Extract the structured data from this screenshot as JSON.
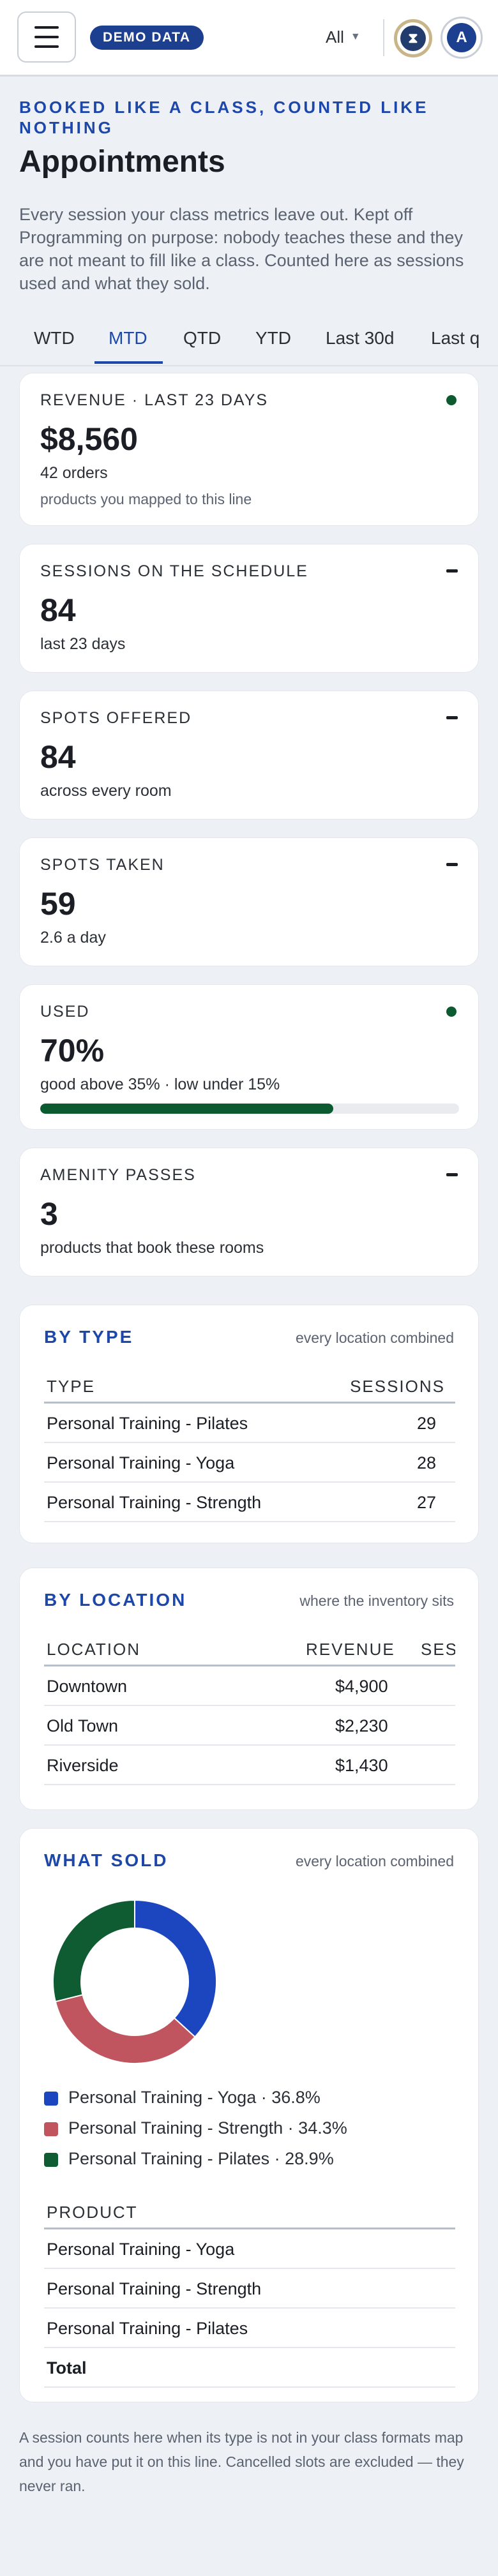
{
  "header": {
    "badge": "DEMO DATA",
    "filter_label": "All",
    "hourglass_glyph": "⧗",
    "avatar_initial": "A"
  },
  "page": {
    "eyebrow": "BOOKED LIKE A CLASS, COUNTED LIKE NOTHING",
    "title": "Appointments",
    "intro": "Every session your class metrics leave out. Kept off Programming on purpose: nobody teaches these and they are not meant to fill like a class. Counted here as sessions used and what they sold."
  },
  "tabs": [
    {
      "label": "WTD"
    },
    {
      "label": "MTD",
      "active": true
    },
    {
      "label": "QTD"
    },
    {
      "label": "YTD"
    },
    {
      "label": "Last 30d"
    },
    {
      "label": "Last q"
    }
  ],
  "kpis": {
    "revenue": {
      "label": "REVENUE · LAST 23 DAYS",
      "value": "$8,560",
      "sub": "42 orders",
      "sub2": "products you mapped to this line",
      "status": "dot"
    },
    "sessions": {
      "label": "SESSIONS ON THE SCHEDULE",
      "value": "84",
      "sub": "last 23 days",
      "status": "dash"
    },
    "spots_offered": {
      "label": "SPOTS OFFERED",
      "value": "84",
      "sub": "across every room",
      "status": "dash"
    },
    "spots_taken": {
      "label": "SPOTS TAKEN",
      "value": "59",
      "sub": "2.6 a day",
      "status": "dash"
    },
    "used": {
      "label": "USED",
      "value": "70%",
      "sub": "good above 35% · low under 15%",
      "progress": 0.7,
      "status": "dot"
    },
    "amenity": {
      "label": "AMENITY PASSES",
      "value": "3",
      "sub": "products that book these rooms",
      "status": "dash"
    }
  },
  "by_type": {
    "title": "BY TYPE",
    "note": "every location combined",
    "columns": [
      "TYPE",
      "SESSIONS"
    ],
    "rows": [
      {
        "name": "Personal Training - Pilates",
        "sessions": "29"
      },
      {
        "name": "Personal Training - Yoga",
        "sessions": "28"
      },
      {
        "name": "Personal Training - Strength",
        "sessions": "27"
      }
    ]
  },
  "by_location": {
    "title": "BY LOCATION",
    "note": "where the inventory sits",
    "columns": [
      "LOCATION",
      "REVENUE",
      "SES"
    ],
    "rows": [
      {
        "name": "Downtown",
        "revenue": "$4,900"
      },
      {
        "name": "Old Town",
        "revenue": "$2,230"
      },
      {
        "name": "Riverside",
        "revenue": "$1,430"
      }
    ]
  },
  "what_sold": {
    "title": "WHAT SOLD",
    "note": "every location combined",
    "legend": [
      {
        "label": "Personal Training - Yoga · 36.8%",
        "color": "#1c46c0"
      },
      {
        "label": "Personal Training - Strength · 34.3%",
        "color": "#c0555f"
      },
      {
        "label": "Personal Training - Pilates · 28.9%",
        "color": "#0f5c32"
      }
    ],
    "product_header": "PRODUCT",
    "products": [
      "Personal Training - Yoga",
      "Personal Training - Strength",
      "Personal Training - Pilates"
    ],
    "total_label": "Total"
  },
  "chart_data": {
    "type": "pie",
    "categories": [
      "Personal Training - Yoga",
      "Personal Training - Strength",
      "Personal Training - Pilates"
    ],
    "values": [
      36.8,
      34.3,
      28.9
    ],
    "colors": [
      "#1c46c0",
      "#c0555f",
      "#0f5c32"
    ],
    "title": "",
    "donut": true
  },
  "footer": {
    "note": "A session counts here when its type is not in your class formats map and you have put it on this line. Cancelled slots are excluded — they never ran."
  }
}
